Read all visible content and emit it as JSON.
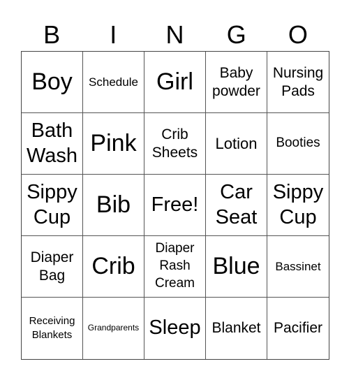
{
  "header": [
    "B",
    "I",
    "N",
    "G",
    "O"
  ],
  "cells": [
    "Boy",
    "Schedule",
    "Girl",
    "Baby powder",
    "Nursing Pads",
    "Bath Wash",
    "Pink",
    "Crib Sheets",
    "Lotion",
    "Booties",
    "Sippy Cup",
    "Bib",
    "Free!",
    "Car Seat",
    "Sippy Cup",
    "Diaper Bag",
    "Crib",
    "Diaper Rash Cream",
    "Blue",
    "Bassinet",
    "Receiving Blankets",
    "Grandparents",
    "Sleep",
    "Blanket",
    "Pacifier"
  ]
}
